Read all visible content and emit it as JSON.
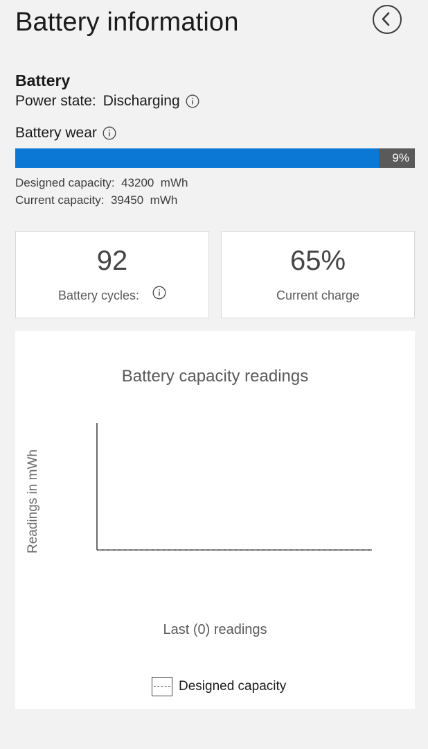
{
  "header": {
    "title": "Battery information",
    "back_icon": "chevron-left-circle-icon"
  },
  "battery": {
    "section_title": "Battery",
    "power_state_label": "Power state:",
    "power_state_value": "Discharging",
    "wear_label": "Battery wear",
    "wear_percent": 9,
    "wear_percent_text": "9%",
    "designed_capacity_text": "Designed capacity:  43200  mWh",
    "current_capacity_text": "Current capacity:  39450  mWh"
  },
  "stats": {
    "cycles_value": "92",
    "cycles_label": "Battery cycles:",
    "charge_value": "65%",
    "charge_label": "Current charge"
  },
  "colors": {
    "accent": "#0a78d4",
    "bar_track": "#5a5a5a",
    "background": "#f2f2f2"
  },
  "chart_data": {
    "type": "line",
    "title": "Battery capacity readings",
    "ylabel": "Readings in mWh",
    "xlabel": "Last (0) readings",
    "series": [
      {
        "name": "Designed capacity",
        "style": "dashed",
        "values": []
      }
    ],
    "legend": [
      "Designed capacity"
    ],
    "legend_placement": "bottom-center",
    "grid": false
  }
}
